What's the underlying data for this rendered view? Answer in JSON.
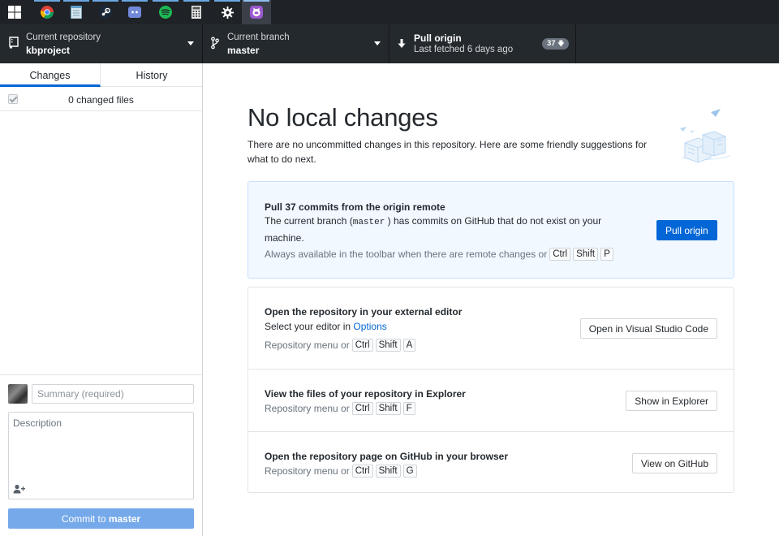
{
  "taskbar": {
    "icons": [
      "windows-start-icon",
      "chrome-icon",
      "notepad-icon",
      "steam-icon",
      "discord-icon",
      "spotify-icon",
      "calculator-icon",
      "settings-icon",
      "github-desktop-icon"
    ]
  },
  "toolbar": {
    "repo": {
      "title": "Current repository",
      "value": "kbproject"
    },
    "branch": {
      "title": "Current branch",
      "value": "master"
    },
    "pull": {
      "title": "Pull origin",
      "subtitle": "Last fetched 6 days ago",
      "badge": "37"
    }
  },
  "sidebar": {
    "tabs": [
      {
        "label": "Changes",
        "active": true
      },
      {
        "label": "History",
        "active": false
      }
    ],
    "changed_files": "0 changed files",
    "summary_placeholder": "Summary (required)",
    "description_placeholder": "Description",
    "commit_prefix": "Commit to ",
    "commit_branch": "master"
  },
  "main": {
    "title": "No local changes",
    "lede": "There are no uncommitted changes in this repository. Here are some friendly suggestions for what to do next.",
    "pull_card": {
      "title": "Pull 37 commits from the origin remote",
      "text_before": "The current branch (",
      "branch_code": "master",
      "text_after": ") has commits on GitHub that do not exist on your machine.",
      "hint": "Always available in the toolbar when there are remote changes or",
      "keys": [
        "Ctrl",
        "Shift",
        "P"
      ],
      "button": "Pull origin"
    },
    "editor_row": {
      "title": "Open the repository in your external editor",
      "text_before": "Select your editor in ",
      "link": "Options",
      "hint": "Repository menu or",
      "keys": [
        "Ctrl",
        "Shift",
        "A"
      ],
      "button": "Open in Visual Studio Code"
    },
    "explorer_row": {
      "title": "View the files of your repository in Explorer",
      "hint": "Repository menu or",
      "keys": [
        "Ctrl",
        "Shift",
        "F"
      ],
      "button": "Show in Explorer"
    },
    "github_row": {
      "title": "Open the repository page on GitHub in your browser",
      "hint": "Repository menu or",
      "keys": [
        "Ctrl",
        "Shift",
        "G"
      ],
      "button": "View on GitHub"
    }
  },
  "colors": {
    "toolbar_bg": "#24292e",
    "accent": "#0366d6",
    "commit_button": "#75a9ea",
    "pull_card_bg": "#f1f8ff"
  }
}
